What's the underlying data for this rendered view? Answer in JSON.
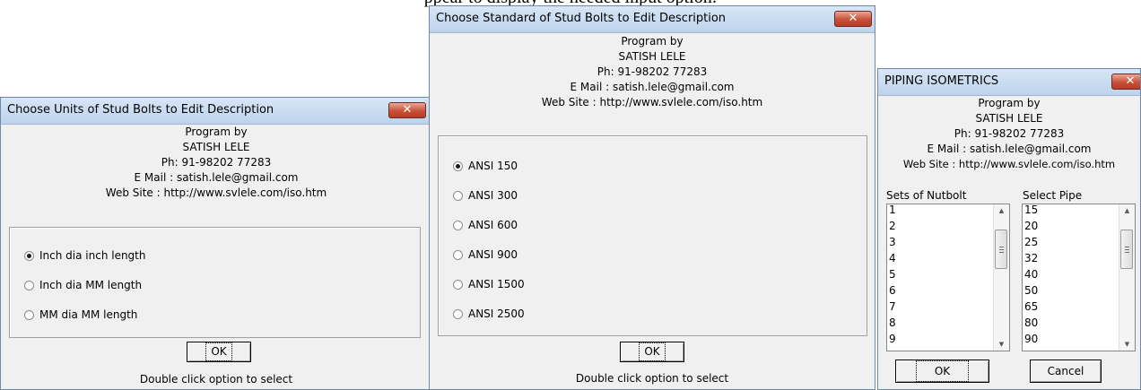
{
  "background_caption": "ppear to display the needed input option:",
  "common": {
    "program_by": "Program by",
    "author": "SATISH LELE",
    "phone": "Ph: 91-98202 77283",
    "email": "E Mail : satish.lele@gmail.com",
    "website": "Web Site : http://www.svlele.com/iso.htm",
    "close_glyph": "✕"
  },
  "units_dialog": {
    "title": "Choose Units of Stud Bolts to Edit Description",
    "options": [
      {
        "label": "Inch dia inch length",
        "selected": true
      },
      {
        "label": "Inch dia MM length",
        "selected": false
      },
      {
        "label": "MM dia MM length",
        "selected": false
      }
    ],
    "ok_label": "OK",
    "hint": "Double click option to select"
  },
  "standard_dialog": {
    "title": "Choose Standard of Stud Bolts to Edit Description",
    "options": [
      {
        "label": "ANSI 150",
        "selected": true
      },
      {
        "label": "ANSI 300",
        "selected": false
      },
      {
        "label": "ANSI 600",
        "selected": false
      },
      {
        "label": "ANSI 900",
        "selected": false
      },
      {
        "label": "ANSI 1500",
        "selected": false
      },
      {
        "label": "ANSI 2500",
        "selected": false
      }
    ],
    "ok_label": "OK",
    "hint": "Double click option to select"
  },
  "piping_dialog": {
    "title": "PIPING ISOMETRICS",
    "sets_label": "Sets of Nutbolt",
    "pipe_label": "Select Pipe",
    "sets_items": [
      "1",
      "2",
      "3",
      "4",
      "5",
      "6",
      "7",
      "8",
      "9"
    ],
    "pipe_items": [
      "15",
      "20",
      "25",
      "32",
      "40",
      "50",
      "65",
      "80",
      "90"
    ],
    "ok_label": "OK",
    "cancel_label": "Cancel"
  },
  "colors": {
    "close_button": "#c9503a",
    "title_bar": "#c8dbf0",
    "dialog_face": "#f0f0f0"
  }
}
